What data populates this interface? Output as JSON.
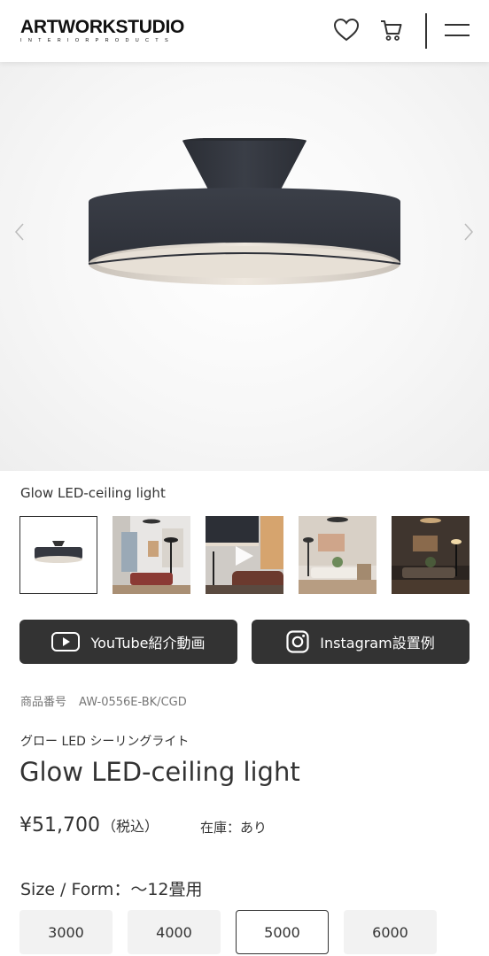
{
  "brand": {
    "name": "ARTWORKSTUDIO",
    "tagline": "INTERIORPRODUCTS"
  },
  "header_icons": [
    "heart-icon",
    "cart-icon",
    "hamburger-menu-icon"
  ],
  "hero": {
    "caption": "Glow LED-ceiling light"
  },
  "thumbnails": [
    "product-lamp",
    "living-room-lamp",
    "video-lamp",
    "living-room-wide",
    "living-room-evening"
  ],
  "buttons": {
    "youtube": "YouTube紹介動画",
    "instagram": "Instagram設置例"
  },
  "product": {
    "sku_label": "商品番号",
    "sku": "AW-0556E-BK/CGD",
    "name_ja": "グロー LED シーリングライト",
    "name_en": "Glow LED-ceiling light",
    "price": "¥51,700",
    "tax": "（税込）",
    "stock": "在庫：あり"
  },
  "size": {
    "label": "Size / Form：〜12畳用",
    "options": [
      "3000",
      "4000",
      "5000",
      "6000"
    ],
    "selected": "5000"
  },
  "colors": {
    "dark": "#333333",
    "option_bg": "#f2f2f2"
  }
}
